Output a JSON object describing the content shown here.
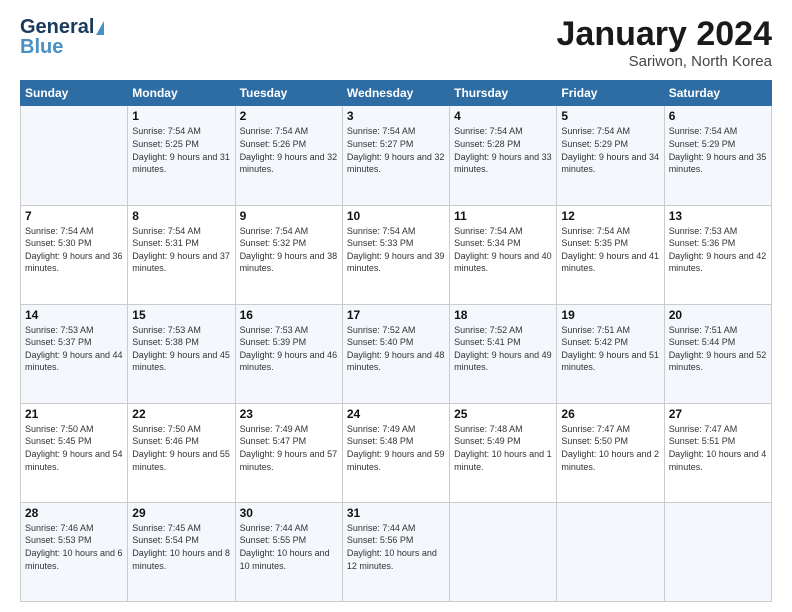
{
  "logo": {
    "line1": "General",
    "line2": "Blue"
  },
  "header": {
    "month": "January 2024",
    "location": "Sariwon, North Korea"
  },
  "weekdays": [
    "Sunday",
    "Monday",
    "Tuesday",
    "Wednesday",
    "Thursday",
    "Friday",
    "Saturday"
  ],
  "weeks": [
    [
      {
        "day": "",
        "sunrise": "",
        "sunset": "",
        "daylight": ""
      },
      {
        "day": "1",
        "sunrise": "Sunrise: 7:54 AM",
        "sunset": "Sunset: 5:25 PM",
        "daylight": "Daylight: 9 hours and 31 minutes."
      },
      {
        "day": "2",
        "sunrise": "Sunrise: 7:54 AM",
        "sunset": "Sunset: 5:26 PM",
        "daylight": "Daylight: 9 hours and 32 minutes."
      },
      {
        "day": "3",
        "sunrise": "Sunrise: 7:54 AM",
        "sunset": "Sunset: 5:27 PM",
        "daylight": "Daylight: 9 hours and 32 minutes."
      },
      {
        "day": "4",
        "sunrise": "Sunrise: 7:54 AM",
        "sunset": "Sunset: 5:28 PM",
        "daylight": "Daylight: 9 hours and 33 minutes."
      },
      {
        "day": "5",
        "sunrise": "Sunrise: 7:54 AM",
        "sunset": "Sunset: 5:29 PM",
        "daylight": "Daylight: 9 hours and 34 minutes."
      },
      {
        "day": "6",
        "sunrise": "Sunrise: 7:54 AM",
        "sunset": "Sunset: 5:29 PM",
        "daylight": "Daylight: 9 hours and 35 minutes."
      }
    ],
    [
      {
        "day": "7",
        "sunrise": "Sunrise: 7:54 AM",
        "sunset": "Sunset: 5:30 PM",
        "daylight": "Daylight: 9 hours and 36 minutes."
      },
      {
        "day": "8",
        "sunrise": "Sunrise: 7:54 AM",
        "sunset": "Sunset: 5:31 PM",
        "daylight": "Daylight: 9 hours and 37 minutes."
      },
      {
        "day": "9",
        "sunrise": "Sunrise: 7:54 AM",
        "sunset": "Sunset: 5:32 PM",
        "daylight": "Daylight: 9 hours and 38 minutes."
      },
      {
        "day": "10",
        "sunrise": "Sunrise: 7:54 AM",
        "sunset": "Sunset: 5:33 PM",
        "daylight": "Daylight: 9 hours and 39 minutes."
      },
      {
        "day": "11",
        "sunrise": "Sunrise: 7:54 AM",
        "sunset": "Sunset: 5:34 PM",
        "daylight": "Daylight: 9 hours and 40 minutes."
      },
      {
        "day": "12",
        "sunrise": "Sunrise: 7:54 AM",
        "sunset": "Sunset: 5:35 PM",
        "daylight": "Daylight: 9 hours and 41 minutes."
      },
      {
        "day": "13",
        "sunrise": "Sunrise: 7:53 AM",
        "sunset": "Sunset: 5:36 PM",
        "daylight": "Daylight: 9 hours and 42 minutes."
      }
    ],
    [
      {
        "day": "14",
        "sunrise": "Sunrise: 7:53 AM",
        "sunset": "Sunset: 5:37 PM",
        "daylight": "Daylight: 9 hours and 44 minutes."
      },
      {
        "day": "15",
        "sunrise": "Sunrise: 7:53 AM",
        "sunset": "Sunset: 5:38 PM",
        "daylight": "Daylight: 9 hours and 45 minutes."
      },
      {
        "day": "16",
        "sunrise": "Sunrise: 7:53 AM",
        "sunset": "Sunset: 5:39 PM",
        "daylight": "Daylight: 9 hours and 46 minutes."
      },
      {
        "day": "17",
        "sunrise": "Sunrise: 7:52 AM",
        "sunset": "Sunset: 5:40 PM",
        "daylight": "Daylight: 9 hours and 48 minutes."
      },
      {
        "day": "18",
        "sunrise": "Sunrise: 7:52 AM",
        "sunset": "Sunset: 5:41 PM",
        "daylight": "Daylight: 9 hours and 49 minutes."
      },
      {
        "day": "19",
        "sunrise": "Sunrise: 7:51 AM",
        "sunset": "Sunset: 5:42 PM",
        "daylight": "Daylight: 9 hours and 51 minutes."
      },
      {
        "day": "20",
        "sunrise": "Sunrise: 7:51 AM",
        "sunset": "Sunset: 5:44 PM",
        "daylight": "Daylight: 9 hours and 52 minutes."
      }
    ],
    [
      {
        "day": "21",
        "sunrise": "Sunrise: 7:50 AM",
        "sunset": "Sunset: 5:45 PM",
        "daylight": "Daylight: 9 hours and 54 minutes."
      },
      {
        "day": "22",
        "sunrise": "Sunrise: 7:50 AM",
        "sunset": "Sunset: 5:46 PM",
        "daylight": "Daylight: 9 hours and 55 minutes."
      },
      {
        "day": "23",
        "sunrise": "Sunrise: 7:49 AM",
        "sunset": "Sunset: 5:47 PM",
        "daylight": "Daylight: 9 hours and 57 minutes."
      },
      {
        "day": "24",
        "sunrise": "Sunrise: 7:49 AM",
        "sunset": "Sunset: 5:48 PM",
        "daylight": "Daylight: 9 hours and 59 minutes."
      },
      {
        "day": "25",
        "sunrise": "Sunrise: 7:48 AM",
        "sunset": "Sunset: 5:49 PM",
        "daylight": "Daylight: 10 hours and 1 minute."
      },
      {
        "day": "26",
        "sunrise": "Sunrise: 7:47 AM",
        "sunset": "Sunset: 5:50 PM",
        "daylight": "Daylight: 10 hours and 2 minutes."
      },
      {
        "day": "27",
        "sunrise": "Sunrise: 7:47 AM",
        "sunset": "Sunset: 5:51 PM",
        "daylight": "Daylight: 10 hours and 4 minutes."
      }
    ],
    [
      {
        "day": "28",
        "sunrise": "Sunrise: 7:46 AM",
        "sunset": "Sunset: 5:53 PM",
        "daylight": "Daylight: 10 hours and 6 minutes."
      },
      {
        "day": "29",
        "sunrise": "Sunrise: 7:45 AM",
        "sunset": "Sunset: 5:54 PM",
        "daylight": "Daylight: 10 hours and 8 minutes."
      },
      {
        "day": "30",
        "sunrise": "Sunrise: 7:44 AM",
        "sunset": "Sunset: 5:55 PM",
        "daylight": "Daylight: 10 hours and 10 minutes."
      },
      {
        "day": "31",
        "sunrise": "Sunrise: 7:44 AM",
        "sunset": "Sunset: 5:56 PM",
        "daylight": "Daylight: 10 hours and 12 minutes."
      },
      {
        "day": "",
        "sunrise": "",
        "sunset": "",
        "daylight": ""
      },
      {
        "day": "",
        "sunrise": "",
        "sunset": "",
        "daylight": ""
      },
      {
        "day": "",
        "sunrise": "",
        "sunset": "",
        "daylight": ""
      }
    ]
  ]
}
